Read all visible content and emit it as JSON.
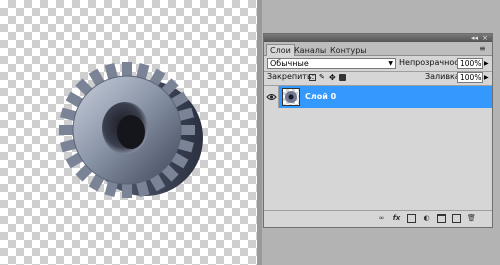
{
  "canvas": {
    "object": "gear-image"
  },
  "panel": {
    "tabs": [
      {
        "label": "Слои",
        "active": true
      },
      {
        "label": "Каналы",
        "active": false
      },
      {
        "label": "Контуры",
        "active": false
      }
    ],
    "titlebar": {
      "collapse": "◂◂",
      "close": "×"
    },
    "menu_icon": "≡",
    "blend_mode": "Обычные",
    "opacity_label": "Непрозрачность:",
    "opacity_value": "100%",
    "lock_label": "Закрепить:",
    "fill_label": "Заливка:",
    "fill_value": "100%",
    "layers": [
      {
        "name": "Слой 0",
        "visible": true,
        "selected": true
      }
    ],
    "footer_icons": [
      "link-icon",
      "fx-icon",
      "mask-icon",
      "adjustment-icon",
      "group-folder-icon",
      "new-layer-icon",
      "trash-icon"
    ]
  },
  "colors": {
    "selection": "#3399ff",
    "panel_bg": "#d6d6d6",
    "workspace": "#b3b3b3"
  }
}
